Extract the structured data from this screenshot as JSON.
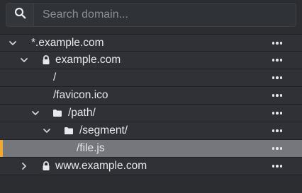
{
  "search": {
    "placeholder": "Search domain...",
    "value": "",
    "icon": "search-icon"
  },
  "tree": {
    "rows": [
      {
        "label": "*.example.com",
        "chevron": "chevron-down-icon",
        "icon": null,
        "more": "more-icon",
        "selected": false
      },
      {
        "label": "example.com",
        "chevron": "chevron-down-icon",
        "icon": "lock-icon",
        "more": "more-icon",
        "selected": false
      },
      {
        "label": "/",
        "chevron": null,
        "icon": null,
        "more": "more-icon",
        "selected": false
      },
      {
        "label": "/favicon.ico",
        "chevron": null,
        "icon": null,
        "more": "more-icon",
        "selected": false
      },
      {
        "label": "/path/",
        "chevron": "chevron-down-icon",
        "icon": "folder-icon",
        "more": "more-icon",
        "selected": false
      },
      {
        "label": "/segment/",
        "chevron": "chevron-down-icon",
        "icon": "folder-icon",
        "more": "more-icon",
        "selected": false
      },
      {
        "label": "/file.js",
        "chevron": null,
        "icon": null,
        "more": "more-icon",
        "selected": true
      },
      {
        "label": "www.example.com",
        "chevron": "chevron-right-icon",
        "icon": "lock-icon",
        "more": "more-icon",
        "selected": false
      }
    ]
  },
  "colors": {
    "background": "#2b2d31",
    "row": "#2f3136",
    "selected_row": "#75777c",
    "selected_accent": "#f0a830",
    "text": "#e8e9eb"
  }
}
